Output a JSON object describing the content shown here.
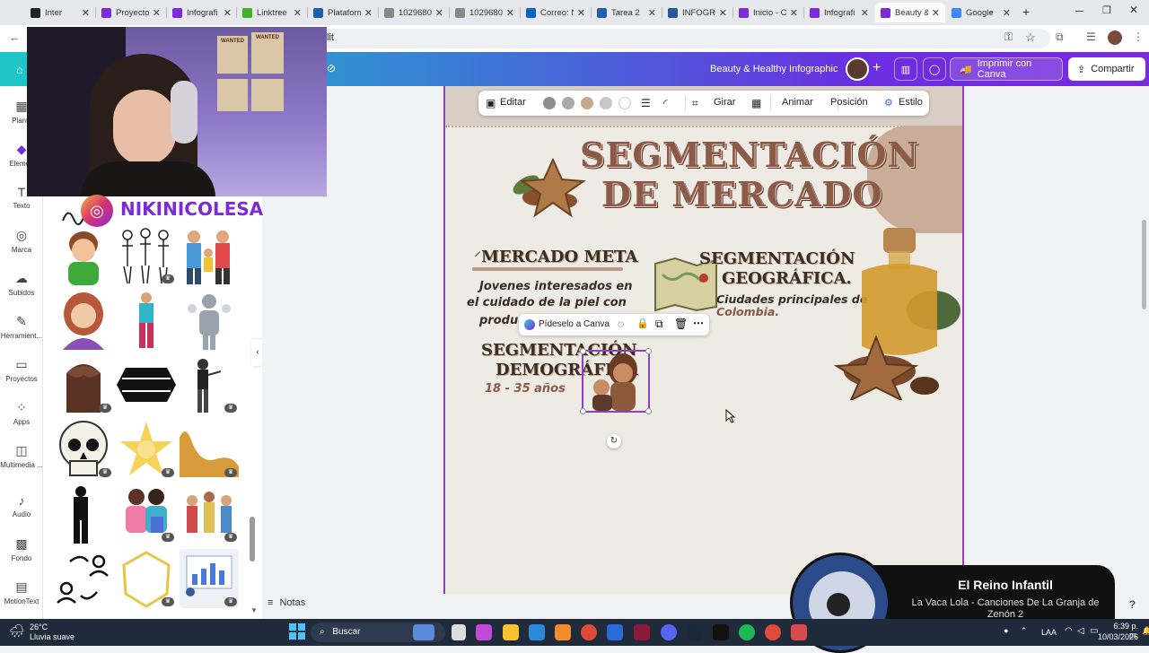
{
  "browser": {
    "tabs": [
      {
        "label": "Inter",
        "color": "#222222"
      },
      {
        "label": "Proyecto",
        "color": "#7b2bdc"
      },
      {
        "label": "Infografi",
        "color": "#7b2bdc"
      },
      {
        "label": "Linktree",
        "color": "#43b02a"
      },
      {
        "label": "Plataform",
        "color": "#1e5fb4"
      },
      {
        "label": "1029680",
        "color": "#888888"
      },
      {
        "label": "1029680",
        "color": "#888888"
      },
      {
        "label": "Correo: N",
        "color": "#0a64c8"
      },
      {
        "label": "Tarea 2",
        "color": "#1e5fb4"
      },
      {
        "label": "INFOGR/",
        "color": "#2b579a"
      },
      {
        "label": "Inicio - C",
        "color": "#7b2bdc"
      },
      {
        "label": "Infografi",
        "color": "#7b2bdc"
      },
      {
        "label": "Beauty &",
        "color": "#7b2bdc"
      },
      {
        "label": "Google",
        "color": "#4285f4"
      }
    ],
    "new_tab": "+",
    "url_fragment": "lit"
  },
  "canva": {
    "design_title": "Beauty & Healthy Infographic",
    "print_button": "Imprimir con Canva",
    "share_button": "Compartir"
  },
  "rail": [
    {
      "label": "Plantil",
      "icon": "template-icon"
    },
    {
      "label": "Elemen",
      "icon": "elements-icon"
    },
    {
      "label": "Texto",
      "icon": "text-icon"
    },
    {
      "label": "Marca",
      "icon": "brand-icon"
    },
    {
      "label": "Subidos",
      "icon": "upload-icon"
    },
    {
      "label": "Herramient...",
      "icon": "pen-icon"
    },
    {
      "label": "Proyectos",
      "icon": "folder-icon"
    },
    {
      "label": "Apps",
      "icon": "apps-icon"
    },
    {
      "label": "Multimedia ...",
      "icon": "media-icon"
    },
    {
      "label": "Audio",
      "icon": "audio-icon"
    },
    {
      "label": "Fondo",
      "icon": "background-icon"
    },
    {
      "label": "MotionText",
      "icon": "motiontext-icon"
    }
  ],
  "toolbar": {
    "edit": "Editar",
    "rotate": "Girar",
    "animate": "Animar",
    "position": "Posición",
    "style": "Estilo",
    "swatches": [
      "#8e8e8e",
      "#a9a9a9",
      "#c8a88c",
      "#c6c6c6",
      "#ffffff"
    ]
  },
  "minibar": {
    "ask": "Pídeselo a Canva"
  },
  "infographic": {
    "title_line1": "SEGMENTACIÓN",
    "title_line2": "DE MERCADO",
    "target_heading": "MERCADO META",
    "target_text_1": "Jovenes interesados en",
    "target_text_2": "el cuidado de la piel con",
    "target_text_3": "produ",
    "demo_heading_1": "SEGMENTACIÓN",
    "demo_heading_2": "DEMOGRÁFICA",
    "demo_text": "18 - 35 años",
    "geo_heading_1": "SEGMENTACIÓN",
    "geo_heading_2": "GEOGRÁFICA.",
    "geo_text_1": "Ciudades principales de",
    "geo_text_2": "Colombia."
  },
  "notes": "Notas",
  "webcam": {
    "poster_1": "WANTED",
    "poster_2": "WANTED",
    "handle": "NIKINICOLESA"
  },
  "taskbar": {
    "temperature": "26°C",
    "weather": "Lluvia suave",
    "search": "Buscar",
    "lang": "LAA",
    "time": "6:39 p. m.",
    "date": "10/03/2026"
  },
  "nowplaying": {
    "artist": "El Reino Infantil",
    "track": "La Vaca Lola - Canciones De La Granja de Zenón 2"
  }
}
